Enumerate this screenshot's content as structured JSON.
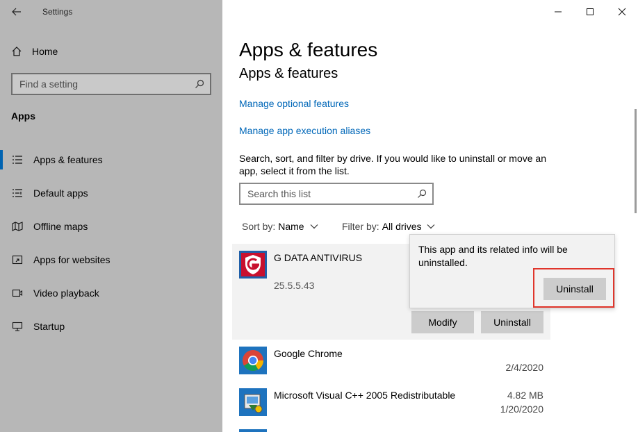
{
  "window": {
    "title": "Settings"
  },
  "sidebar": {
    "home_label": "Home",
    "search_placeholder": "Find a setting",
    "section_label": "Apps",
    "items": [
      {
        "label": "Apps & features",
        "icon": "apps-features-icon",
        "active": true
      },
      {
        "label": "Default apps",
        "icon": "default-apps-icon",
        "active": false
      },
      {
        "label": "Offline maps",
        "icon": "offline-maps-icon",
        "active": false
      },
      {
        "label": "Apps for websites",
        "icon": "apps-for-websites-icon",
        "active": false
      },
      {
        "label": "Video playback",
        "icon": "video-playback-icon",
        "active": false
      },
      {
        "label": "Startup",
        "icon": "startup-icon",
        "active": false
      }
    ]
  },
  "main": {
    "heading": "Apps & features",
    "subheading": "Apps & features",
    "links": {
      "optional_features": "Manage optional features",
      "execution_aliases": "Manage app execution aliases"
    },
    "description": "Search, sort, and filter by drive. If you would like to uninstall or move an app, select it from the list.",
    "list_search_placeholder": "Search this list",
    "sort": {
      "label": "Sort by:",
      "value": "Name"
    },
    "filter": {
      "label": "Filter by:",
      "value": "All drives"
    },
    "apps": [
      {
        "name": "G DATA ANTIVIRUS",
        "version": "25.5.5.43",
        "size": "",
        "date": "",
        "selected": true
      },
      {
        "name": "Google Chrome",
        "size": "",
        "date": "2/4/2020"
      },
      {
        "name": "Microsoft Visual C++ 2005 Redistributable",
        "size": "4.82 MB",
        "date": "1/20/2020"
      }
    ],
    "selected_actions": {
      "modify": "Modify",
      "uninstall": "Uninstall"
    },
    "flyout": {
      "message": "This app and its related info will be uninstalled.",
      "uninstall": "Uninstall"
    }
  },
  "colors": {
    "accent": "#0063b1",
    "link": "#0067b8",
    "highlight": "#e0352b",
    "sidebar_bg": "#b7b7b7"
  }
}
